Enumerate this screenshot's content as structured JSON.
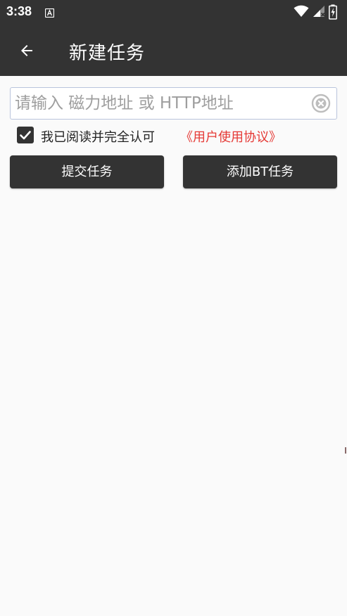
{
  "status_bar": {
    "time": "3:38",
    "notification_icon": "font-icon",
    "icons": [
      "wifi-icon",
      "signal-icon",
      "battery-charging-icon"
    ]
  },
  "app_bar": {
    "back_icon": "arrow-back-icon",
    "title": "新建任务"
  },
  "url_field": {
    "value": "",
    "placeholder": "请输入 磁力地址 或 HTTP地址",
    "clear_icon": "clear-circle-icon"
  },
  "agreement": {
    "checked": true,
    "text": "我已阅读并完全认可",
    "link_text": "《用户使用协议》",
    "link_color": "#e53935"
  },
  "buttons": {
    "submit_label": "提交任务",
    "add_bt_label": "添加BT任务"
  },
  "colors": {
    "primary": "#333333",
    "background": "#fafafa",
    "accent_link": "#e53935"
  }
}
